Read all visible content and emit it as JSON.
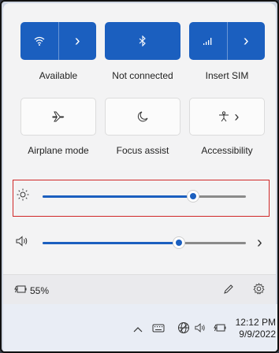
{
  "tiles": {
    "wifi": {
      "label": "Available",
      "icon": "wifi-icon",
      "chevron": "›"
    },
    "bluetooth": {
      "label": "Not connected",
      "icon": "bluetooth-icon"
    },
    "cellular": {
      "label": "Insert SIM",
      "icon": "cellular-icon",
      "chevron": "›"
    },
    "airplane": {
      "label": "Airplane mode",
      "icon": "airplane-icon"
    },
    "focus": {
      "label": "Focus assist",
      "icon": "moon-icon"
    },
    "accessibility": {
      "label": "Accessibility",
      "icon": "accessibility-icon",
      "chevron": "›"
    }
  },
  "sliders": {
    "brightness": {
      "icon": "sun-icon",
      "value_percent": 74
    },
    "volume": {
      "icon": "speaker-icon",
      "value_percent": 67,
      "chevron": "›"
    }
  },
  "footer": {
    "battery_text": "55%",
    "battery_icon": "battery-icon",
    "edit_icon": "pencil-icon",
    "settings_icon": "gear-icon"
  },
  "taskbar": {
    "time": "12:12 PM",
    "date": "9/9/2022",
    "icons": [
      "chevron-up-icon",
      "keyboard-icon",
      "network-icon",
      "speaker-icon",
      "battery-icon"
    ]
  },
  "colors": {
    "accent": "#1b5fbf",
    "highlight": "#d02727"
  }
}
